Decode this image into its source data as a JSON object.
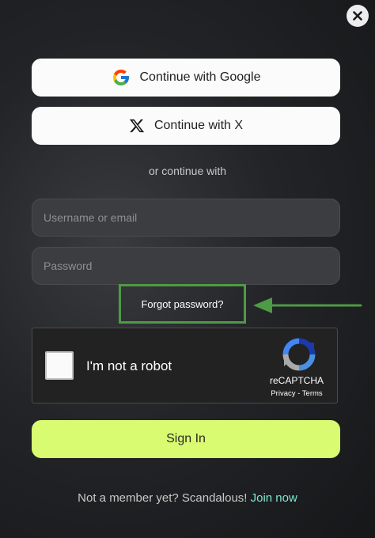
{
  "auth": {
    "google_label": "Continue with Google",
    "x_label": "Continue with X",
    "divider": "or continue with",
    "username_placeholder": "Username or email",
    "password_placeholder": "Password",
    "forgot_label": "Forgot password?",
    "signin_label": "Sign In",
    "footer_text": "Not a member yet? Scandalous!",
    "join_label": "Join now"
  },
  "recaptcha": {
    "label": "I'm not a robot",
    "brand": "reCAPTCHA",
    "privacy": "Privacy",
    "separator": " - ",
    "terms": "Terms"
  },
  "icons": {
    "close": "close-icon",
    "google": "google-icon",
    "x": "x-logo-icon",
    "recaptcha": "recaptcha-logo-icon",
    "arrow": "arrow-left-icon"
  },
  "colors": {
    "signin_bg": "#d9fb71",
    "join_link": "#7ee8d4",
    "highlight": "#4f9a45"
  }
}
